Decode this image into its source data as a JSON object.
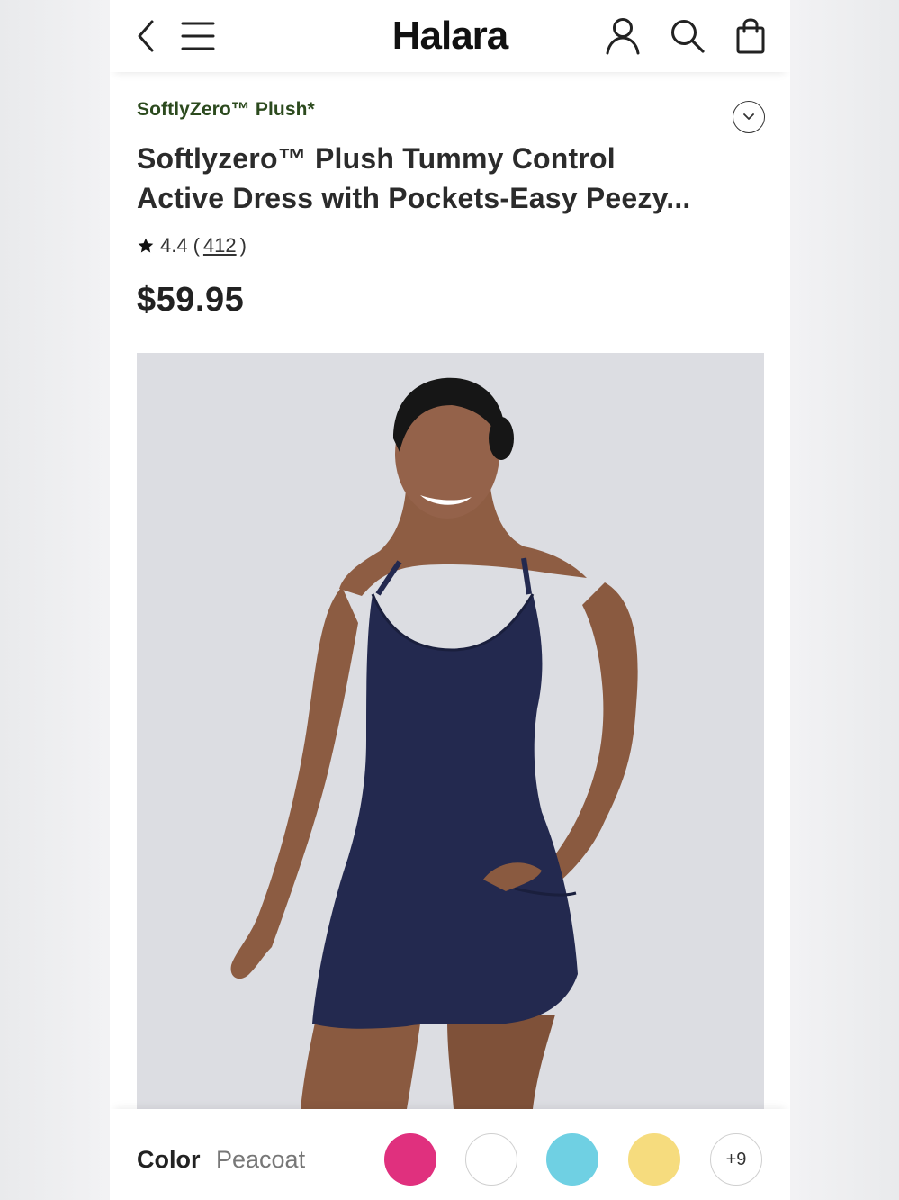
{
  "header": {
    "logo": "Halara",
    "icons": [
      "back-icon",
      "menu-icon",
      "account-icon",
      "search-icon",
      "bag-icon"
    ]
  },
  "product": {
    "collection": "SoftlyZero™ Plush*",
    "title_line1": "Softlyzero™ Plush Tummy Control",
    "title_line2": "Active Dress with Pockets-Easy Peezy...",
    "rating": "4.4",
    "rating_open": "(",
    "review_count": "412",
    "rating_close": ")",
    "price": "$59.95",
    "image_description": "model wearing navy active dress"
  },
  "color_picker": {
    "label": "Color",
    "selected": "Peacoat",
    "swatches": [
      {
        "name": "pink",
        "color": "#e0307e"
      },
      {
        "name": "white",
        "color": "#ffffff"
      },
      {
        "name": "sky-blue",
        "color": "#6fd0e3"
      },
      {
        "name": "yellow",
        "color": "#f6dc7e"
      }
    ],
    "more_label": "+9"
  },
  "colors": {
    "collection_green": "#2c4a1e",
    "dress_navy": "#23294f",
    "hero_bg": "#dcdde2"
  }
}
